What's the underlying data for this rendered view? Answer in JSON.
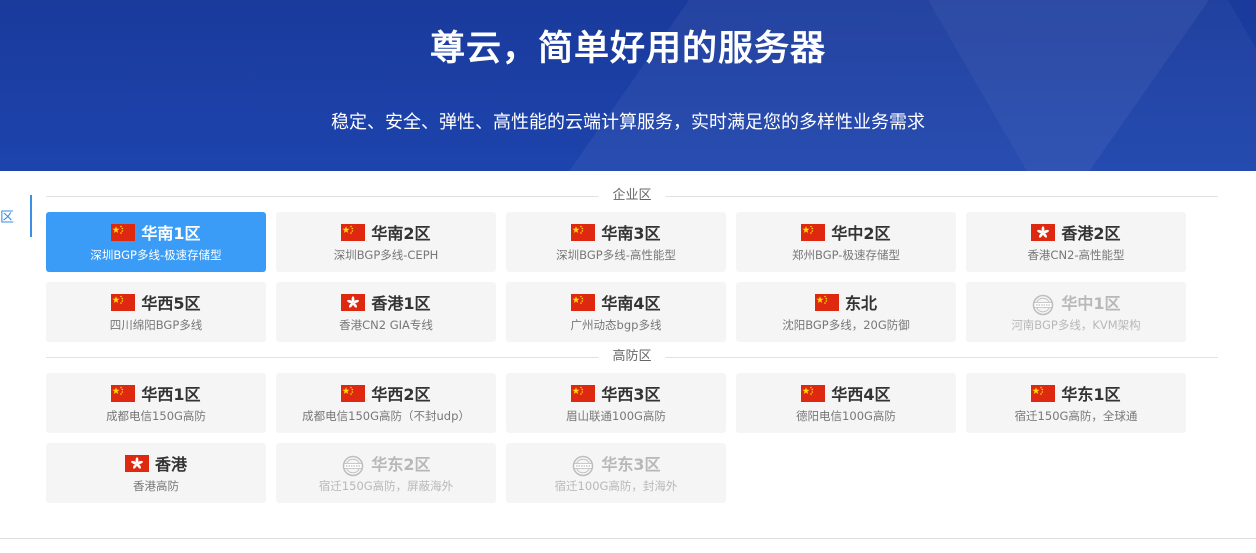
{
  "hero": {
    "title": "尊云，简单好用的服务器",
    "subtitle": "稳定、安全、弹性、高性能的云端计算服务，实时满足您的多样性业务需求"
  },
  "side_tab": {
    "label": "区"
  },
  "colors": {
    "hero_bg": "#1d44ad",
    "active": "#3a9cf7",
    "card_bg": "#f5f5f5"
  },
  "sections": [
    {
      "label": "企业区",
      "cards": [
        {
          "name": "华南1区",
          "desc": "深圳BGP多线-极速存储型",
          "flag": "cn-flag-icon",
          "active": true
        },
        {
          "name": "华南2区",
          "desc": "深圳BGP多线-CEPH",
          "flag": "cn-flag-icon"
        },
        {
          "name": "华南3区",
          "desc": "深圳BGP多线-高性能型",
          "flag": "cn-flag-icon"
        },
        {
          "name": "华中2区",
          "desc": "郑州BGP-极速存储型",
          "flag": "cn-flag-icon"
        },
        {
          "name": "香港2区",
          "desc": "香港CN2-高性能型",
          "flag": "hk-flag-icon"
        },
        {
          "name": "华西5区",
          "desc": "四川绵阳BGP多线",
          "flag": "cn-flag-icon"
        },
        {
          "name": "香港1区",
          "desc": "香港CN2 GIA专线",
          "flag": "hk-flag-icon"
        },
        {
          "name": "华南4区",
          "desc": "广州动态bgp多线",
          "flag": "cn-flag-icon"
        },
        {
          "name": "东北",
          "desc": "沈阳BGP多线，20G防御",
          "flag": "cn-flag-icon"
        },
        {
          "name": "华中1区",
          "desc": "河南BGP多线，KVM架构",
          "flag": "sold-out-stamp-icon",
          "disabled": true
        }
      ]
    },
    {
      "label": "高防区",
      "cards": [
        {
          "name": "华西1区",
          "desc": "成都电信150G高防",
          "flag": "cn-flag-icon"
        },
        {
          "name": "华西2区",
          "desc": "成都电信150G高防（不封udp）",
          "flag": "cn-flag-icon"
        },
        {
          "name": "华西3区",
          "desc": "眉山联通100G高防",
          "flag": "cn-flag-icon"
        },
        {
          "name": "华西4区",
          "desc": "德阳电信100G高防",
          "flag": "cn-flag-icon"
        },
        {
          "name": "华东1区",
          "desc": "宿迁150G高防，全球通",
          "flag": "cn-flag-icon"
        },
        {
          "name": "香港",
          "desc": "香港高防",
          "flag": "hk-flag-icon"
        },
        {
          "name": "华东2区",
          "desc": "宿迁150G高防，屏蔽海外",
          "flag": "sold-out-stamp-icon",
          "disabled": true
        },
        {
          "name": "华东3区",
          "desc": "宿迁100G高防，封海外",
          "flag": "sold-out-stamp-icon",
          "disabled": true
        }
      ]
    }
  ]
}
